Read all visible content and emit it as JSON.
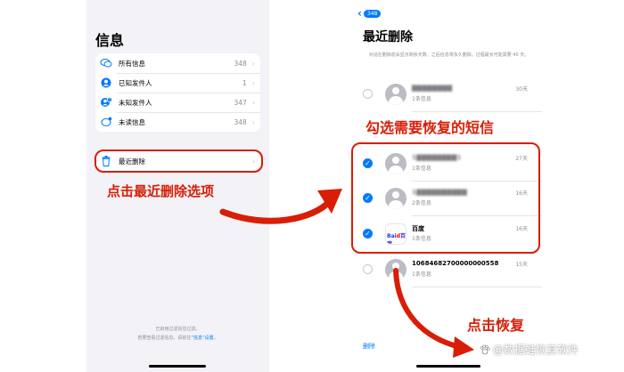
{
  "left_screen": {
    "title": "信息",
    "filters": [
      {
        "label": "所有信息",
        "count": "348",
        "icon": "chat-bubbles-icon"
      },
      {
        "label": "已知发件人",
        "count": "1",
        "icon": "person-circle-icon"
      },
      {
        "label": "未知发件人",
        "count": "347",
        "icon": "person-question-icon"
      },
      {
        "label": "未读信息",
        "count": "348",
        "icon": "unread-bubble-icon"
      }
    ],
    "recently_deleted": {
      "label": "最近删除",
      "icon": "trash-icon"
    },
    "footnote_line1": "已启用过滤信息过滤。",
    "footnote_line2": "若要查看过滤信息，请前往",
    "footnote_link": "“信息”设置",
    "footnote_end": "。"
  },
  "right_screen": {
    "back_badge": "348",
    "title": "最近删除",
    "description": "对话在删除前会显示剩余天数。之后信息将永久删除。过程最长可能需要 40 天。",
    "messages": [
      {
        "sender": "▇▇▇▇▇▇▇▇",
        "subtitle": "1条信息",
        "days": "30天",
        "checked": false,
        "avatar": "person",
        "blurred": true
      },
      {
        "sender": "1▇▇▇▇▇▇▇▇1",
        "subtitle": "1条信息",
        "days": "27天",
        "checked": true,
        "avatar": "person",
        "blurred": true
      },
      {
        "sender": "1▇▇▇▇▇▇▇▇▇▇",
        "subtitle": "2条信息",
        "days": "16天",
        "checked": true,
        "avatar": "person",
        "blurred": true
      },
      {
        "sender": "百度",
        "subtitle": "1条信息",
        "days": "16天",
        "checked": true,
        "avatar": "baidu",
        "blurred": false
      },
      {
        "sender": "10684682700000000558",
        "subtitle": "1条信息",
        "days": "15天",
        "checked": false,
        "avatar": "person",
        "blurred": false
      }
    ],
    "delete_label": "删除",
    "recover_label": "恢复"
  },
  "annotations": {
    "tap_recently_deleted": "点击最近删除选项",
    "select_messages": "勾选需要恢复的短信",
    "tap_recover": "点击恢复",
    "accent_color": "#d81e06"
  },
  "watermark": "@数据蛙恢复软件",
  "baidu_logo": {
    "part1": "Bai",
    "mark": "d",
    "part2": "百度"
  }
}
